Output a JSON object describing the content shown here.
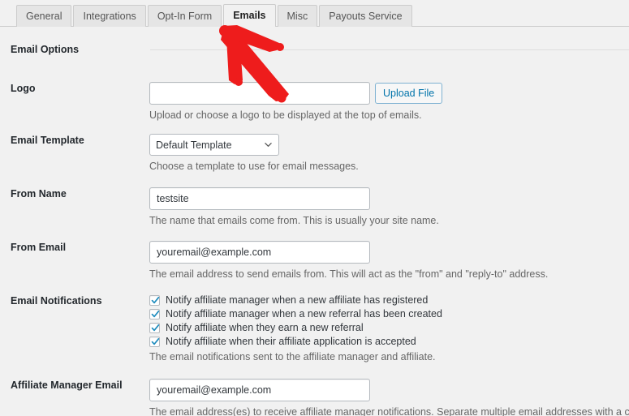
{
  "tabs": [
    {
      "label": "General",
      "active": false
    },
    {
      "label": "Integrations",
      "active": false
    },
    {
      "label": "Opt-In Form",
      "active": false
    },
    {
      "label": "Emails",
      "active": true
    },
    {
      "label": "Misc",
      "active": false
    },
    {
      "label": "Payouts Service",
      "active": false
    }
  ],
  "section": {
    "title": "Email Options"
  },
  "rows": {
    "logo": {
      "label": "Logo",
      "value": "",
      "placeholder": "",
      "button": "Upload File",
      "desc": "Upload or choose a logo to be displayed at the top of emails."
    },
    "email_template": {
      "label": "Email Template",
      "selected": "Default Template",
      "options": [
        "Default Template"
      ],
      "desc": "Choose a template to use for email messages."
    },
    "from_name": {
      "label": "From Name",
      "value": "testsite",
      "desc": "The name that emails come from. This is usually your site name."
    },
    "from_email": {
      "label": "From Email",
      "value": "youremail@example.com",
      "desc": "The email address to send emails from. This will act as the \"from\" and \"reply-to\" address."
    },
    "email_notifications": {
      "label": "Email Notifications",
      "checkboxes": [
        {
          "label": "Notify affiliate manager when a new affiliate has registered",
          "checked": true
        },
        {
          "label": "Notify affiliate manager when a new referral has been created",
          "checked": true
        },
        {
          "label": "Notify affiliate when they earn a new referral",
          "checked": true
        },
        {
          "label": "Notify affiliate when their affiliate application is accepted",
          "checked": true
        }
      ],
      "desc": "The email notifications sent to the affiliate manager and affiliate."
    },
    "affiliate_manager_email": {
      "label": "Affiliate Manager Email",
      "value": "youremail@example.com",
      "desc": "The email address(es) to receive affiliate manager notifications. Separate multiple email addresses with a comma (,). The adr"
    }
  },
  "annotation": {
    "type": "arrow",
    "color": "#ee1c1c",
    "points_to": "Emails"
  },
  "colors": {
    "page_bg": "#f1f1f1",
    "tab_inactive_bg": "#e5e5e5",
    "accent_blue": "#0073aa",
    "annotation_red": "#ee1c1c",
    "label_text": "#23282d",
    "desc_text": "#666666"
  }
}
